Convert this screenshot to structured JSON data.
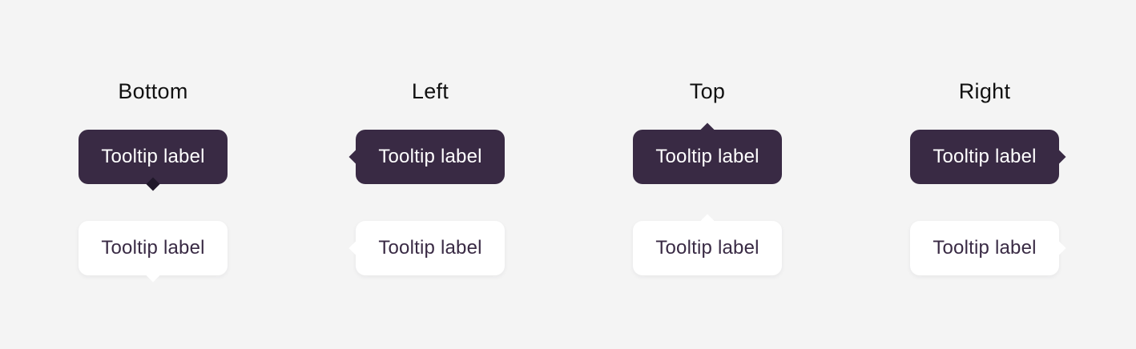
{
  "columns": [
    {
      "title": "Bottom",
      "dark_label": "Tooltip label",
      "light_label": "Tooltip label",
      "arrow": "bottom"
    },
    {
      "title": "Left",
      "dark_label": "Tooltip label",
      "light_label": "Tooltip label",
      "arrow": "left"
    },
    {
      "title": "Top",
      "dark_label": "Tooltip label",
      "light_label": "Tooltip label",
      "arrow": "top"
    },
    {
      "title": "Right",
      "dark_label": "Tooltip label",
      "light_label": "Tooltip label",
      "arrow": "right"
    }
  ],
  "colors": {
    "background": "#f4f4f4",
    "dark_tooltip": "#392a44",
    "light_tooltip": "#ffffff",
    "dark_text": "#ffffff",
    "light_text": "#392a44"
  }
}
